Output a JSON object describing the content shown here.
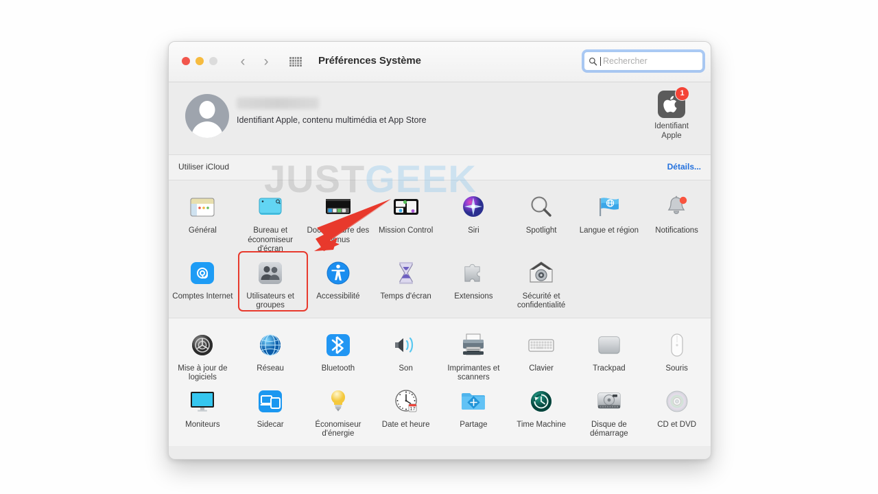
{
  "window": {
    "title": "Préférences Système",
    "traffic_lights": [
      "close",
      "minimize",
      "zoom"
    ],
    "nav": {
      "back": "‹",
      "forward": "›"
    },
    "grid_button": "show-all-grid-icon"
  },
  "search": {
    "placeholder": "Rechercher",
    "value": "",
    "icon": "search-icon",
    "focus_color": "#4b91f0"
  },
  "account": {
    "name_blurred": "",
    "subtitle": "Identifiant Apple, contenu multimédia et App Store",
    "apple_id": {
      "label_line1": "Identifiant",
      "label_line2": "Apple",
      "badge": "1",
      "badge_color": "#f44336"
    }
  },
  "icloud": {
    "label": "Utiliser iCloud",
    "details_link": "Détails..."
  },
  "watermark": {
    "part1": "JUST",
    "part2": "GEEK"
  },
  "annotation": {
    "highlight_target": "Utilisateurs et groupes",
    "highlight_color": "#e8392c",
    "arrow_color": "#e8392c"
  },
  "sections": [
    {
      "id": "personal",
      "rows": [
        [
          {
            "label": "Général",
            "icon": "general-icon"
          },
          {
            "label": "Bureau et économiseur d'écran",
            "icon": "desktop-screensaver-icon"
          },
          {
            "label": "Dock et barre des menus",
            "icon": "dock-menubar-icon"
          },
          {
            "label": "Mission Control",
            "icon": "mission-control-icon"
          },
          {
            "label": "Siri",
            "icon": "siri-icon"
          },
          {
            "label": "Spotlight",
            "icon": "spotlight-icon"
          },
          {
            "label": "Langue et région",
            "icon": "language-region-icon"
          },
          {
            "label": "Notifications",
            "icon": "notifications-icon"
          }
        ],
        [
          {
            "label": "Comptes Internet",
            "icon": "internet-accounts-icon"
          },
          {
            "label": "Utilisateurs et groupes",
            "icon": "users-groups-icon"
          },
          {
            "label": "Accessibilité",
            "icon": "accessibility-icon"
          },
          {
            "label": "Temps d'écran",
            "icon": "screen-time-icon"
          },
          {
            "label": "Extensions",
            "icon": "extensions-icon"
          },
          {
            "label": "Sécurité et confidentialité",
            "icon": "security-privacy-icon"
          }
        ]
      ]
    },
    {
      "id": "hardware",
      "rows": [
        [
          {
            "label": "Mise à jour de logiciels",
            "icon": "software-update-icon"
          },
          {
            "label": "Réseau",
            "icon": "network-icon"
          },
          {
            "label": "Bluetooth",
            "icon": "bluetooth-icon"
          },
          {
            "label": "Son",
            "icon": "sound-icon"
          },
          {
            "label": "Imprimantes et scanners",
            "icon": "printers-scanners-icon"
          },
          {
            "label": "Clavier",
            "icon": "keyboard-icon"
          },
          {
            "label": "Trackpad",
            "icon": "trackpad-icon"
          },
          {
            "label": "Souris",
            "icon": "mouse-icon"
          }
        ],
        [
          {
            "label": "Moniteurs",
            "icon": "displays-icon"
          },
          {
            "label": "Sidecar",
            "icon": "sidecar-icon"
          },
          {
            "label": "Économiseur d'énergie",
            "icon": "energy-saver-icon"
          },
          {
            "label": "Date et heure",
            "icon": "date-time-icon",
            "day": "17"
          },
          {
            "label": "Partage",
            "icon": "sharing-icon"
          },
          {
            "label": "Time Machine",
            "icon": "time-machine-icon"
          },
          {
            "label": "Disque de démarrage",
            "icon": "startup-disk-icon"
          },
          {
            "label": "CD et DVD",
            "icon": "cd-dvd-icon"
          }
        ]
      ]
    }
  ]
}
